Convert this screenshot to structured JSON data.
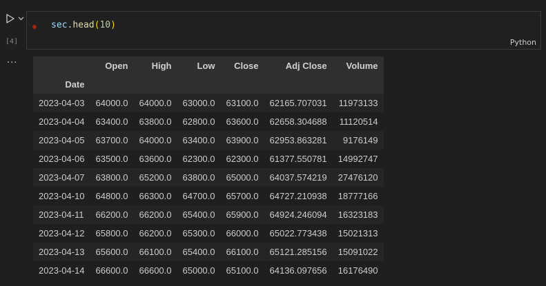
{
  "cell": {
    "execution_count": "[4]",
    "code": {
      "var": "sec",
      "dot": ".",
      "fn": "head",
      "open": "(",
      "arg": "10",
      "close": ")"
    },
    "language": "Python"
  },
  "output": {
    "ellipsis": "...",
    "index_name": "Date",
    "columns": [
      "Open",
      "High",
      "Low",
      "Close",
      "Adj Close",
      "Volume"
    ],
    "rows": [
      [
        "2023-04-03",
        "64000.0",
        "64000.0",
        "63000.0",
        "63100.0",
        "62165.707031",
        "11973133"
      ],
      [
        "2023-04-04",
        "63400.0",
        "63800.0",
        "62800.0",
        "63600.0",
        "62658.304688",
        "11120514"
      ],
      [
        "2023-04-05",
        "63700.0",
        "64000.0",
        "63400.0",
        "63900.0",
        "62953.863281",
        "9176149"
      ],
      [
        "2023-04-06",
        "63500.0",
        "63600.0",
        "62300.0",
        "62300.0",
        "61377.550781",
        "14992747"
      ],
      [
        "2023-04-07",
        "63800.0",
        "65200.0",
        "63800.0",
        "65000.0",
        "64037.574219",
        "27476120"
      ],
      [
        "2023-04-10",
        "64800.0",
        "66300.0",
        "64700.0",
        "65700.0",
        "64727.210938",
        "18777166"
      ],
      [
        "2023-04-11",
        "66200.0",
        "66200.0",
        "65400.0",
        "65900.0",
        "64924.246094",
        "16323183"
      ],
      [
        "2023-04-12",
        "65800.0",
        "66200.0",
        "65300.0",
        "66000.0",
        "65022.773438",
        "15021313"
      ],
      [
        "2023-04-13",
        "65600.0",
        "66100.0",
        "65400.0",
        "66100.0",
        "65121.285156",
        "15091022"
      ],
      [
        "2023-04-14",
        "66600.0",
        "66600.0",
        "65000.0",
        "65100.0",
        "64136.097656",
        "16176490"
      ]
    ]
  }
}
